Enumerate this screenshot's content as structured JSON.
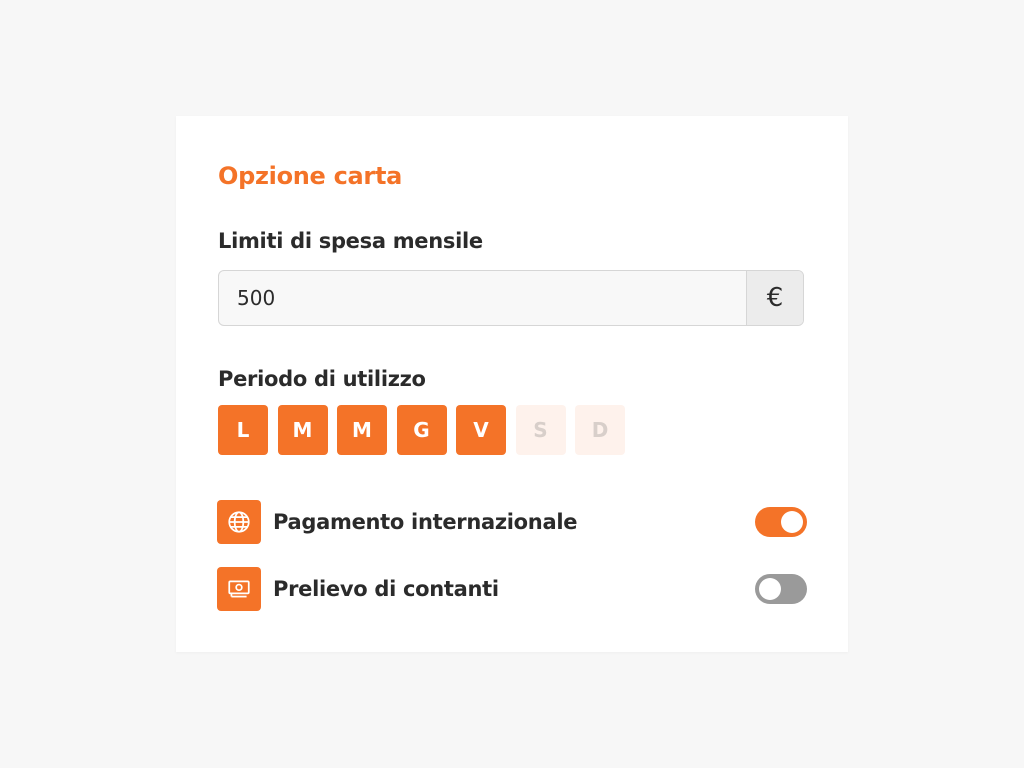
{
  "card": {
    "title": "Opzione carta",
    "limit": {
      "label": "Limiti di spesa mensile",
      "value": "500",
      "currency_symbol": "€"
    },
    "period": {
      "label": "Periodo di utilizzo",
      "days": [
        {
          "letter": "L",
          "active": true
        },
        {
          "letter": "M",
          "active": true
        },
        {
          "letter": "M",
          "active": true
        },
        {
          "letter": "G",
          "active": true
        },
        {
          "letter": "V",
          "active": true
        },
        {
          "letter": "S",
          "active": false
        },
        {
          "letter": "D",
          "active": false
        }
      ]
    },
    "options": {
      "international": {
        "label": "Pagamento internazionale",
        "icon": "globe-icon",
        "enabled": true
      },
      "cash": {
        "label": "Prelievo di contanti",
        "icon": "cash-icon",
        "enabled": false
      }
    }
  },
  "colors": {
    "accent": "#f47328",
    "accent_light": "#fef2ec",
    "text": "#2b2b2b",
    "toggle_off": "#9a9a9a",
    "background": "#f7f7f7"
  }
}
